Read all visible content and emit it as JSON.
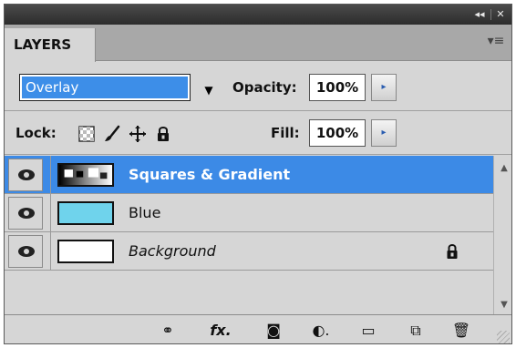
{
  "titlebar": {
    "collapse_icon": "double-chevron-left-icon",
    "collapse_glyph": "◂◂",
    "close_icon": "close-icon",
    "close_glyph": "✕"
  },
  "panel": {
    "tab_label": "LAYERS",
    "menu_icon": "panel-menu-icon",
    "menu_glyph": "▾≡"
  },
  "blend": {
    "mode": "Overlay",
    "arrow_glyph": "▼"
  },
  "opacity": {
    "label": "Opacity:",
    "value": "100%",
    "step_glyph": "▸"
  },
  "lock": {
    "label": "Lock:",
    "icons": [
      "lock-transparent-icon",
      "lock-image-icon",
      "lock-position-icon",
      "lock-all-icon"
    ]
  },
  "fill": {
    "label": "Fill:",
    "value": "100%",
    "step_glyph": "▸"
  },
  "layers": [
    {
      "name": "Squares & Gradient",
      "selected": true,
      "italic": false,
      "thumb": "squares-gradient-thumbnail",
      "locked": false
    },
    {
      "name": "Blue",
      "selected": false,
      "italic": false,
      "thumb": "blue-thumbnail",
      "thumb_color": "#6fd3ec",
      "locked": false
    },
    {
      "name": "Background",
      "selected": false,
      "italic": true,
      "thumb": "white-thumbnail",
      "thumb_color": "#ffffff",
      "locked": true
    }
  ],
  "scrollbar": {
    "up_glyph": "▲",
    "down_glyph": "▼"
  },
  "colors": {
    "selection": "#3c8ae6",
    "panel_bg": "#d6d6d6",
    "blue_layer": "#6fd3ec"
  },
  "bottom_toolbar": {
    "link_glyph": "⚭",
    "fx_glyph": "fx.",
    "mask_glyph": "◙",
    "adjust_glyph": "◐.",
    "folder_glyph": "▭",
    "newlayer_glyph": "⧉",
    "trash_glyph": "🗑"
  }
}
